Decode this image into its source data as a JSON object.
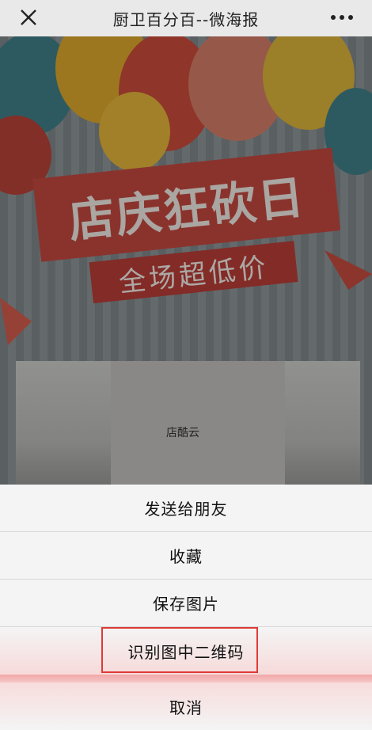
{
  "navbar": {
    "title": "厨卫百分百--微海报",
    "close_icon": "close-icon",
    "more_icon": "more-icon"
  },
  "poster": {
    "headline": "店庆狂砍日",
    "subline": "全场超低价",
    "logo_text": "店酷云"
  },
  "action_sheet": {
    "items": [
      {
        "label": "发送给朋友"
      },
      {
        "label": "收藏"
      },
      {
        "label": "保存图片"
      },
      {
        "label": "识别图中二维码"
      }
    ],
    "cancel_label": "取消"
  },
  "colors": {
    "highlight": "#e03a36",
    "banner": "#c0473f"
  }
}
